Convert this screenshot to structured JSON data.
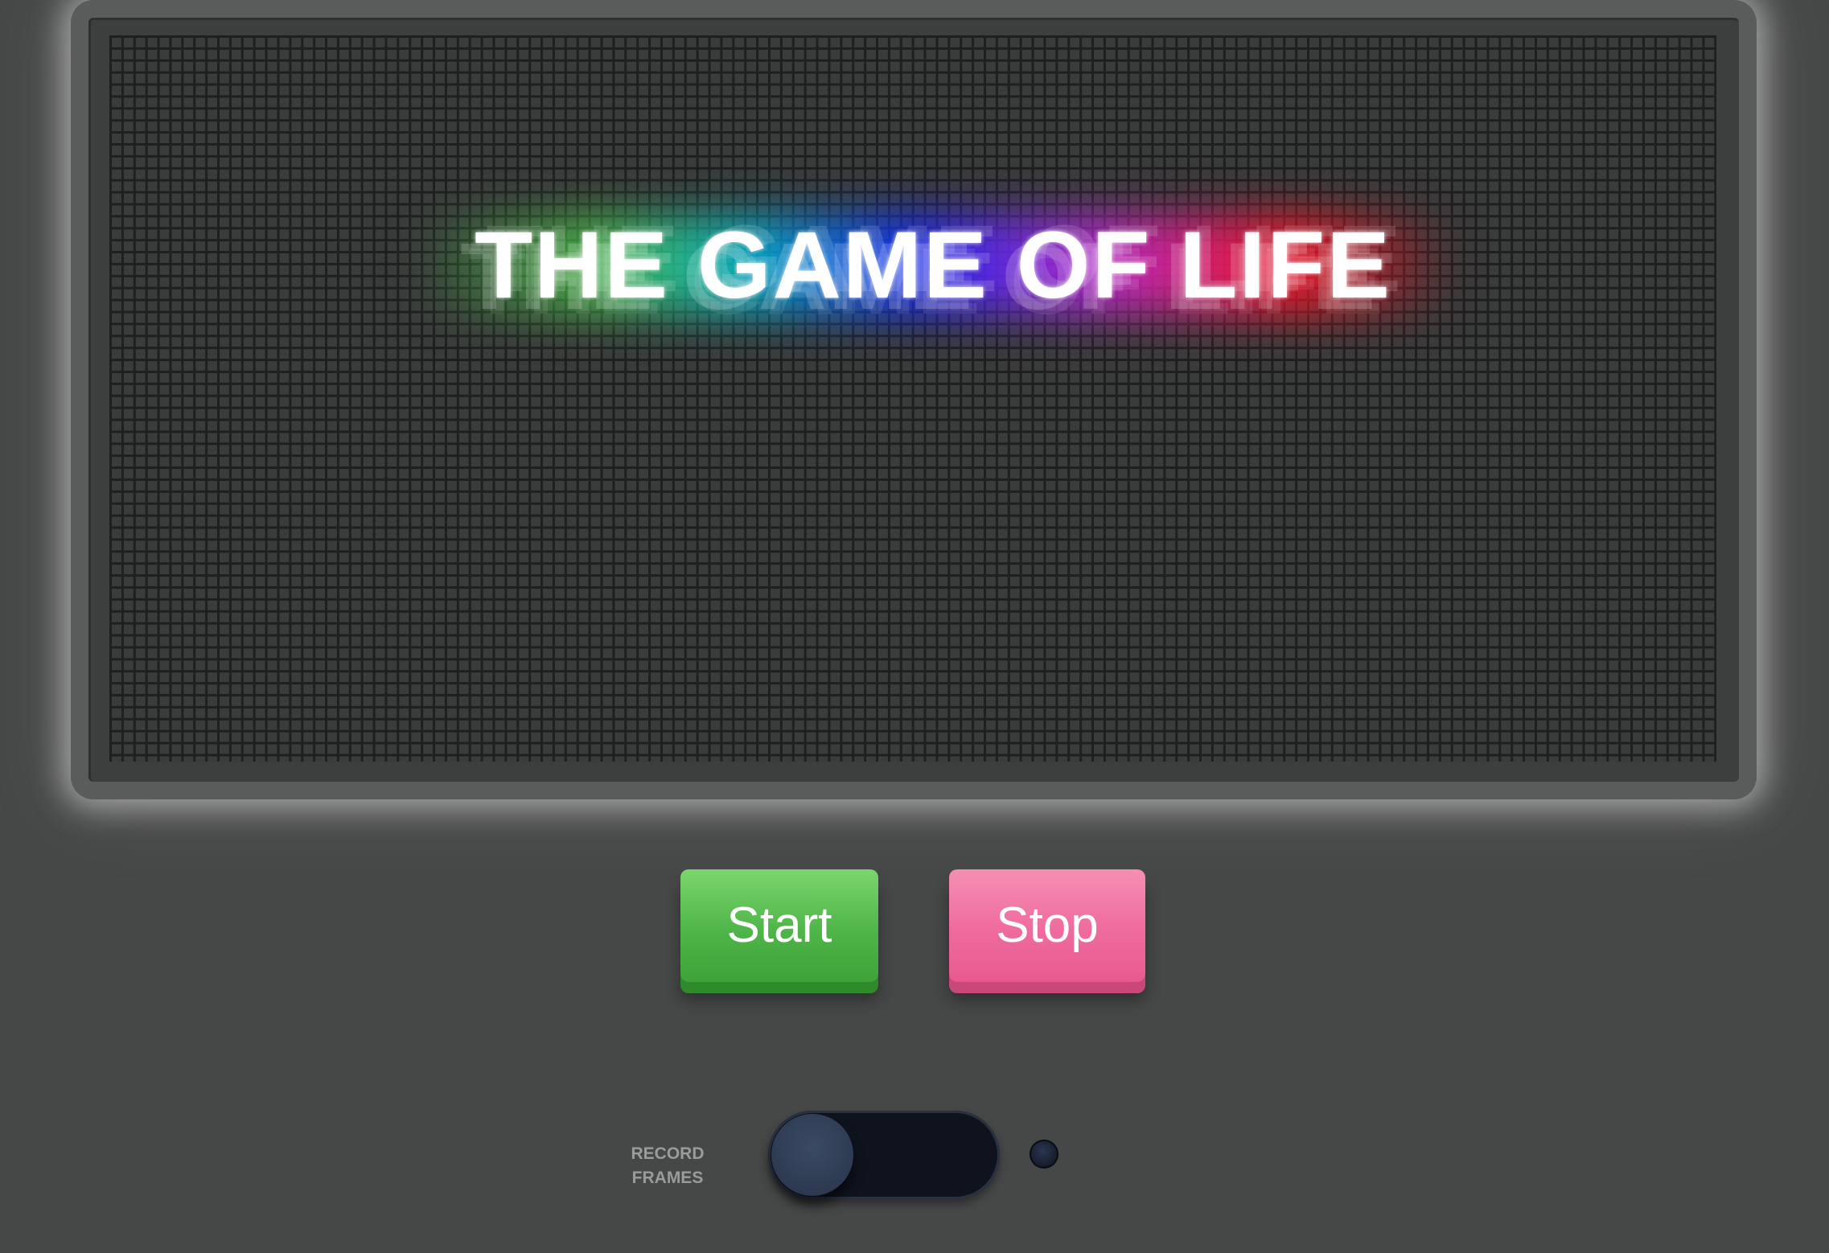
{
  "board": {
    "title": "THE GAME OF LIFE"
  },
  "controls": {
    "start_label": "Start",
    "stop_label": "Stop"
  },
  "record": {
    "label": "RECORD FRAMES",
    "enabled": false
  },
  "colors": {
    "background": "#464747",
    "start": "#4fb548",
    "stop": "#ef6b9d",
    "toggle_track": "#0f131d"
  }
}
